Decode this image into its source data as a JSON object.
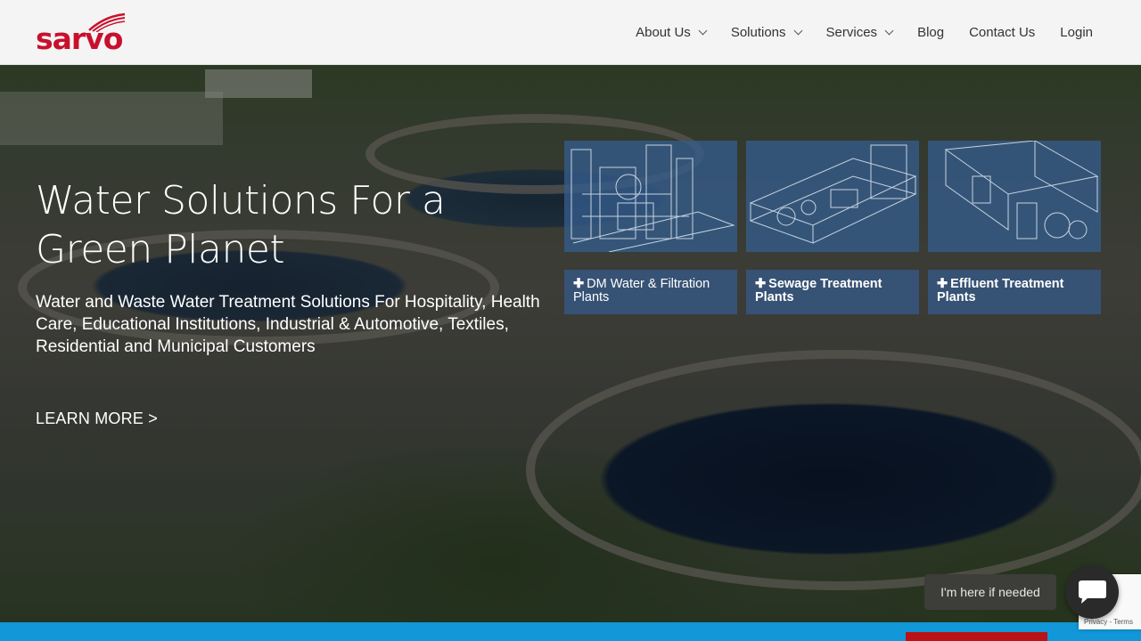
{
  "brand": {
    "logo_text": "sarvo",
    "color": "#c8102e"
  },
  "nav": {
    "items": [
      {
        "label": "About Us",
        "has_dropdown": true
      },
      {
        "label": "Solutions",
        "has_dropdown": true
      },
      {
        "label": "Services",
        "has_dropdown": true
      },
      {
        "label": "Blog",
        "has_dropdown": false
      },
      {
        "label": "Contact Us",
        "has_dropdown": false
      },
      {
        "label": "Login",
        "has_dropdown": false
      }
    ]
  },
  "hero": {
    "title": "Water Solutions For a Green Planet",
    "subtitle": "Water and Waste Water Treatment Solutions For Hospitality, Health Care, Educational Institutions, Industrial & Automotive, Textiles, Residential and Municipal Customers",
    "cta": "LEARN MORE >",
    "cards": [
      {
        "label": "DM Water & Filtration Plants",
        "icon": "plus-icon"
      },
      {
        "label": "Sewage Treatment Plants",
        "icon": "plus-icon"
      },
      {
        "label": "Effluent Treatment Plants",
        "icon": "plus-icon"
      }
    ]
  },
  "chat": {
    "bubble_text": "I'm here if needed",
    "icon": "chat-icon"
  },
  "recaptcha": {
    "text": "Privacy - Terms"
  },
  "colors": {
    "accent_blue": "#1297d8",
    "card_blue": "#345c8c",
    "cta_red": "#b91217"
  }
}
